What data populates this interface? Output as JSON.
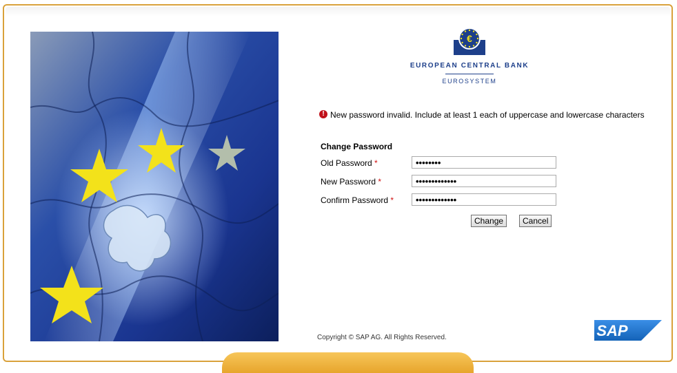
{
  "logo": {
    "title": "EUROPEAN CENTRAL BANK",
    "subtitle": "EUROSYSTEM",
    "symbol": "€"
  },
  "message": {
    "icon": "error-icon",
    "text": "New password invalid. Include at least 1 each of uppercase and lowercase characters"
  },
  "form": {
    "title": "Change Password",
    "fields": [
      {
        "label": "Old Password",
        "required": "*",
        "masked": "••••••••"
      },
      {
        "label": "New Password",
        "required": "*",
        "masked": "•••••••••••••"
      },
      {
        "label": "Confirm Password",
        "required": "*",
        "masked": "•••••••••••••"
      }
    ],
    "change_label": "Change",
    "cancel_label": "Cancel"
  },
  "footer": {
    "copyright": "Copyright © SAP AG. All Rights Reserved.",
    "vendor_logo": "SAP"
  },
  "colors": {
    "frame": "#d9a13a",
    "brand_blue": "#1d3f8a",
    "error_red": "#c0101a"
  }
}
